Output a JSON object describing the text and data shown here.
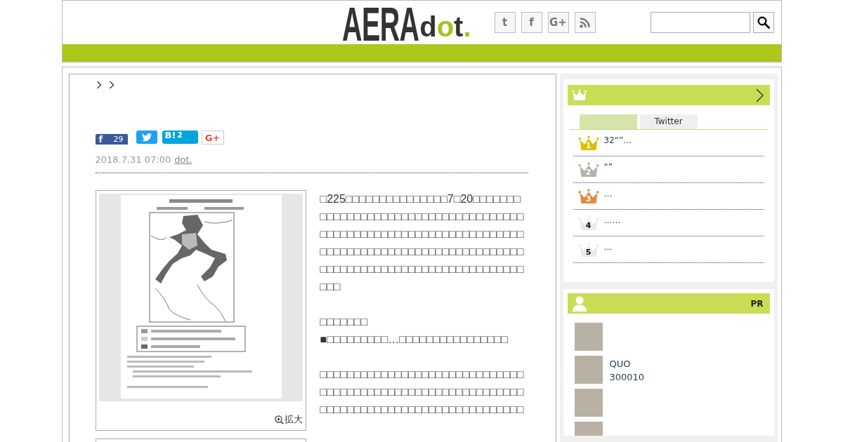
{
  "header": {
    "logo": {
      "main": "AERA",
      "sub": "dot."
    },
    "social_links": [
      {
        "kind": "letter",
        "label": "t"
      },
      {
        "kind": "letter",
        "label": "f"
      },
      {
        "kind": "letter",
        "label": "G+"
      },
      {
        "kind": "rss"
      }
    ]
  },
  "article": {
    "share_buttons": [
      {
        "kind": "facebook",
        "label": "f",
        "count": "29"
      },
      {
        "kind": "twitter"
      },
      {
        "kind": "hatena",
        "label": "B!",
        "count": "2"
      },
      {
        "kind": "google",
        "label": "G+"
      }
    ],
    "date": "2018.7.31 07:00",
    "source": "dot.",
    "figure": {
      "zoom_label": "拡大"
    },
    "paragraphs": [
      "□225□□□□□□□□□□□□□□□7□20□□□□□□□□□□□□□□□□□□□□□□□□□□□□□□□□□□□□□□□□□□□□□□□□□□□□□□□□□□□□□□□□□□□□□□□□□□□□□□□□□□□□□□□□□□□□□□□□□□□□□□□□□□□□□□□□□□□□□□□□□□□□□□□□□□",
      "□□□□□□□\n■□□□□□□□□□…□□□□□□□□□□□□□□□□",
      "□□□□□□□□□□□□□□□□□□□□□□□□□□□□□□□□□□□□□□□□□□□□□□□□□□□□□□□□□□□□□□□□□□□□□□□□□□□□□□□□□□□□□□□□□□"
    ]
  },
  "ranking": {
    "tabs": [
      {
        "selected": true
      },
      {
        "label": "Twitter",
        "selected": false
      }
    ],
    "items": [
      {
        "rank": "1",
        "title": "32“”…",
        "color": "#d8c200"
      },
      {
        "rank": "2",
        "title": "“”",
        "color": "#b3b2a8"
      },
      {
        "rank": "3",
        "title": "…",
        "color": "#e28a3f"
      },
      {
        "rank": "4",
        "title": "……",
        "color": "#ebebeb"
      },
      {
        "rank": "5",
        "title": "…",
        "color": "#ebebeb"
      }
    ]
  },
  "pr": {
    "label": "PR",
    "items": [
      {
        "photo": true
      },
      {
        "photo": true,
        "title": "QUO\n300010"
      },
      {
        "photo": true
      },
      {
        "photo": true
      }
    ]
  }
}
